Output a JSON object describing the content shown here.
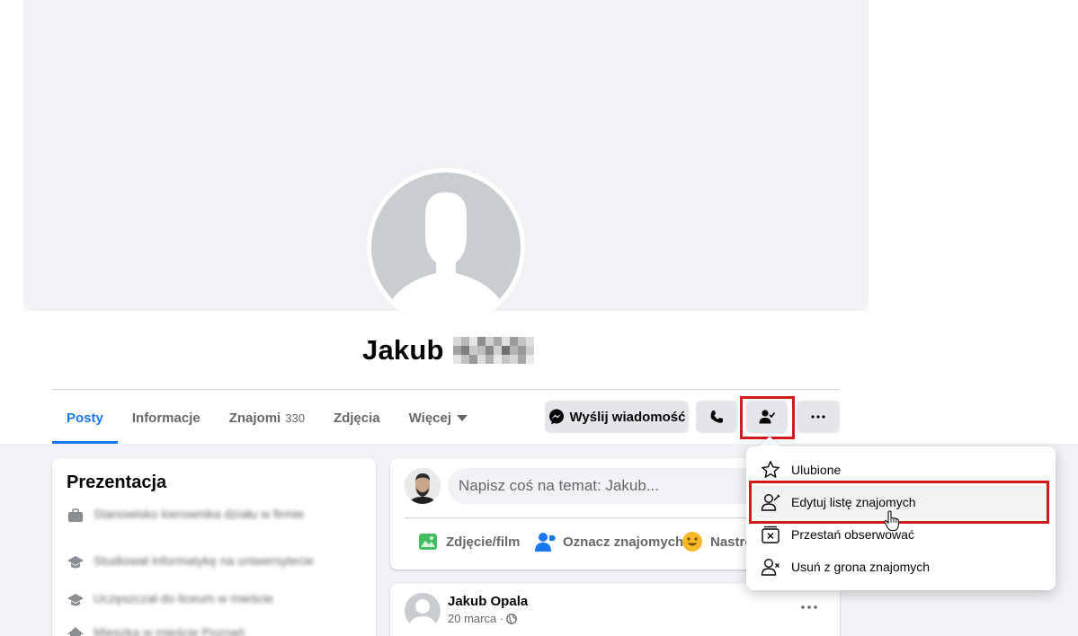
{
  "profile": {
    "name": "Jakub",
    "surname_pixel_colors": [
      "#d8d8d8",
      "#b9b9b9",
      "#e6e6e6",
      "#8e8e8e",
      "#cfcfcf",
      "#a9a9a9",
      "#e0e0e0",
      "#9c9c9c",
      "#c4c4c4",
      "#dedede",
      "#a2a2a2",
      "#7e7e7e",
      "#c9c9c9",
      "#bdbdbd",
      "#8a8a8a",
      "#d2d2d2",
      "#6f6f6f",
      "#b4b4b4",
      "#999999",
      "#cdcdcd",
      "#e4e4e4",
      "#c1c1c1",
      "#9a9a9a",
      "#dcdcdc",
      "#b0b0b0",
      "#e9e9e9",
      "#c6c6c6",
      "#d6d6d6",
      "#a7a7a7",
      "#ebebeb"
    ]
  },
  "tabs": [
    {
      "label": "Posty",
      "active": true
    },
    {
      "label": "Informacje"
    },
    {
      "label": "Znajomi",
      "count": "330"
    },
    {
      "label": "Zdjęcia"
    },
    {
      "label": "Więcej",
      "dropdown": true
    }
  ],
  "actions": {
    "message_label": "Wyślij wiadomość",
    "call_icon": "phone-icon",
    "friends_icon": "friends-check-icon",
    "more_icon": "more-dots-icon"
  },
  "friends_menu": {
    "items": [
      {
        "label": "Ulubione",
        "icon": "star-icon"
      },
      {
        "label": "Edytuj listę znajomych",
        "icon": "edit-friend-list-icon",
        "hovered": true
      },
      {
        "label": "Przestań obserwować",
        "icon": "unfollow-icon"
      },
      {
        "label": "Usuń z grona znajomych",
        "icon": "unfriend-icon"
      }
    ]
  },
  "intro": {
    "title": "Prezentacja",
    "items": [
      {
        "icon": "work-icon",
        "text": "Stanowisko kierownika działu w firmie"
      },
      {
        "icon": "education-icon",
        "text": "Studiował informatykę na uniwersytecie"
      },
      {
        "icon": "education-icon",
        "text": "Uczęszczał do liceum w mieście"
      },
      {
        "icon": "home-icon",
        "text": "Mieszka w mieście Poznań"
      }
    ]
  },
  "composer": {
    "placeholder": "Napisz coś na temat: Jakub...",
    "photo_label": "Zdjęcie/film",
    "tag_label": "Oznacz znajomych",
    "feeling_label": "Nastró"
  },
  "post": {
    "author": "Jakub Opala",
    "date": "20 marca ·"
  },
  "colors": {
    "accent": "#1877f2",
    "highlight": "#d11a1a",
    "photo_green": "#45bd62",
    "feeling_yellow": "#f7b928"
  }
}
